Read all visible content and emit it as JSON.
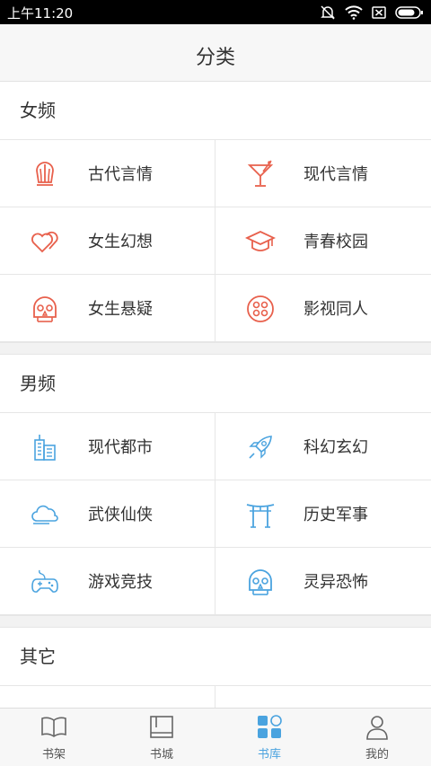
{
  "status_bar": {
    "time": "上午11:20"
  },
  "header": {
    "title": "分类"
  },
  "sections": [
    {
      "title": "女频",
      "items": [
        {
          "label": "古代言情",
          "icon": "crown-icon"
        },
        {
          "label": "现代言情",
          "icon": "cocktail-icon"
        },
        {
          "label": "女生幻想",
          "icon": "hearts-icon"
        },
        {
          "label": "青春校园",
          "icon": "graduation-cap-icon"
        },
        {
          "label": "女生悬疑",
          "icon": "skull-icon"
        },
        {
          "label": "影视同人",
          "icon": "film-reel-icon"
        }
      ]
    },
    {
      "title": "男频",
      "items": [
        {
          "label": "现代都市",
          "icon": "city-icon"
        },
        {
          "label": "科幻玄幻",
          "icon": "rocket-icon"
        },
        {
          "label": "武侠仙侠",
          "icon": "cloud-icon"
        },
        {
          "label": "历史军事",
          "icon": "gate-icon"
        },
        {
          "label": "游戏竞技",
          "icon": "gamepad-icon"
        },
        {
          "label": "灵异恐怖",
          "icon": "skull-icon"
        }
      ]
    },
    {
      "title": "其它",
      "items": []
    }
  ],
  "tabs": [
    {
      "label": "书架",
      "icon": "open-book-icon",
      "active": false
    },
    {
      "label": "书城",
      "icon": "bookstore-icon",
      "active": false
    },
    {
      "label": "书库",
      "icon": "grid-icon",
      "active": true
    },
    {
      "label": "我的",
      "icon": "person-icon",
      "active": false
    }
  ],
  "colors": {
    "female_accent": "#e8604c",
    "male_accent": "#4aa3df",
    "active_tab": "#4aa3df"
  }
}
